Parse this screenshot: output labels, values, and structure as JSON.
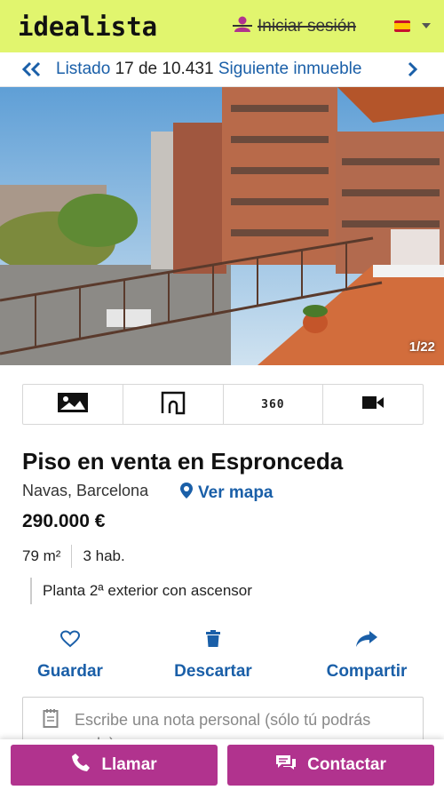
{
  "header": {
    "logo_text": "idealista",
    "login_label": "Iniciar sesión",
    "accent_color": "#e1f56e",
    "login_icon": "user-icon",
    "language_flag": "spain-flag"
  },
  "listing_nav": {
    "back_label": "Listado",
    "current": "17",
    "of_label": "de",
    "total": "10.431",
    "next_label": "Siguiente inmueble"
  },
  "gallery": {
    "counter": "1/22",
    "tabs": [
      {
        "icon": "photos-icon"
      },
      {
        "icon": "floor-plan-icon"
      },
      {
        "label": "360"
      },
      {
        "icon": "video-icon"
      }
    ]
  },
  "property": {
    "title": "Piso en venta en Espronceda",
    "location": "Navas, Barcelona",
    "map_link": "Ver mapa",
    "price": "290.000 €",
    "area": "79 m²",
    "rooms": "3 hab.",
    "detail": "Planta 2ª exterior con ascensor"
  },
  "actions": {
    "save": "Guardar",
    "discard": "Descartar",
    "share": "Compartir"
  },
  "note": {
    "placeholder": "Escribe una nota personal (sólo tú podrás verla)"
  },
  "cta": {
    "call": "Llamar",
    "contact": "Contactar",
    "color": "#b1338e"
  }
}
